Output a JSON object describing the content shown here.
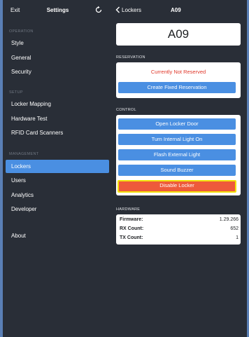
{
  "sidebar": {
    "exit_label": "Exit",
    "title": "Settings",
    "refresh_icon": "refresh-icon",
    "sections": [
      {
        "label": "OPERATION",
        "items": [
          "Style",
          "General",
          "Security"
        ]
      },
      {
        "label": "SETUP",
        "items": [
          "Locker Mapping",
          "Hardware Test",
          "RFID Card Scanners"
        ]
      },
      {
        "label": "MANAGEMENT",
        "items": [
          "Lockers",
          "Users",
          "Analytics",
          "Developer"
        ]
      }
    ],
    "about_label": "About",
    "active_item": "Lockers"
  },
  "nav": {
    "back_label": "Lockers",
    "back_icon": "chevron-left-icon",
    "title": "A09"
  },
  "locker": {
    "id": "A09"
  },
  "reservation": {
    "section_label": "RESERVATION",
    "status": "Currently Not Reserved",
    "create_button": "Create Fixed Reservation"
  },
  "control": {
    "section_label": "CONTROL",
    "open_door": "Open Locker Door",
    "internal_light": "Turn Internal Light On",
    "flash_light": "Flash External Light",
    "buzzer": "Sound Buzzer",
    "disable": "Disable Locker"
  },
  "hardware": {
    "section_label": "HARDWARE",
    "rows": [
      {
        "key": "Firmware:",
        "value": "1.29.266"
      },
      {
        "key": "RX Count:",
        "value": "652"
      },
      {
        "key": "TX Count:",
        "value": "1"
      }
    ]
  },
  "colors": {
    "background": "#292e37",
    "accent": "#4a8fe2",
    "danger": "#ee5a3b",
    "highlight_border": "#f2e20b",
    "status_red": "#e0382b",
    "frame_border": "#5a7fb5"
  }
}
